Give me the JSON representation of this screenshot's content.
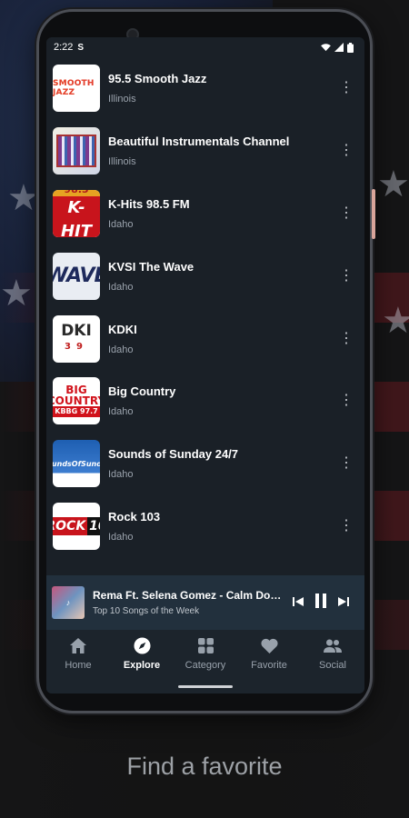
{
  "status_bar": {
    "time": "2:22",
    "app_glyph": "S"
  },
  "stations": [
    {
      "name": "95.5 Smooth Jazz",
      "location": "Illinois",
      "logo_text": "SMOOTH JAZZ"
    },
    {
      "name": "Beautiful Instrumentals Channel",
      "location": "Illinois",
      "logo_text": ""
    },
    {
      "name": "K-Hits 98.5 FM",
      "location": "Idaho",
      "logo_text": "98.5 K-HIT"
    },
    {
      "name": "KVSI The Wave",
      "location": "Idaho",
      "logo_text": "WAVE"
    },
    {
      "name": "KDKI",
      "location": "Idaho",
      "logo_text": "DKI"
    },
    {
      "name": "Big Country",
      "location": "Idaho",
      "logo_text": "BIG COUNTRY"
    },
    {
      "name": "Sounds of Sunday 24/7",
      "location": "Idaho",
      "logo_text": "SoundsOfSunday"
    },
    {
      "name": "Rock 103",
      "location": "Idaho",
      "logo_text": "ROCK 10"
    }
  ],
  "player": {
    "title": "Rema Ft. Selena Gomez - Calm Down",
    "subtitle": "Top 10 Songs of the Week"
  },
  "nav": [
    {
      "label": "Home",
      "icon": "home-icon",
      "active": false
    },
    {
      "label": "Explore",
      "icon": "compass-icon",
      "active": true
    },
    {
      "label": "Category",
      "icon": "grid-icon",
      "active": false
    },
    {
      "label": "Favorite",
      "icon": "heart-icon",
      "active": false
    },
    {
      "label": "Social",
      "icon": "people-icon",
      "active": false
    }
  ],
  "caption": "Find a favorite",
  "colors": {
    "screen_bg": "#1a2027",
    "player_bg": "#22303d",
    "nav_bg": "#1c242c"
  }
}
